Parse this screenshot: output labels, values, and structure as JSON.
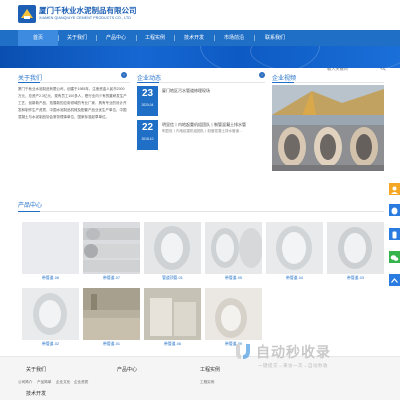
{
  "header": {
    "company_name": "厦门千秋业水泥制品有限公司",
    "company_name_en": "XIAMEN QIANQIUYE CEMENT PRODUCTS CO., LTD"
  },
  "nav": {
    "items": [
      "首页",
      "关于我们",
      "产品中心",
      "工程实例",
      "技术开发",
      "市场前沿",
      "联系我们"
    ],
    "search_placeholder": "输入关键词"
  },
  "about": {
    "title": "关于我们",
    "text": "厦门千秋业水泥制品有限公司，创建于1985年，注册资金人民币2000万元，总资产2.3亿元，现有员工100多人，是行业内少有的集研发生产工艺、创新新产品、拓展新的应用领域的专业厂家，具有专业的设计开发和制作生产资质、中国水泥制品机械及配套产品业优生产单位、中国混凝土与水泥制品协会常务理事单位、国家标准起草单位。"
  },
  "news": {
    "title": "企业动态",
    "items": [
      {
        "day": "23",
        "ym": "2020-04",
        "title": "厦门地区污水管道修理现场",
        "desc": ""
      },
      {
        "day": "22",
        "ym": "2018-10",
        "title": "明显信丨内地起重机组团队丨制管混凝土排水管",
        "desc": "明显信丨内地起重机组团队丨制管混凝土排水管道…"
      }
    ]
  },
  "video": {
    "title": "企业视频"
  },
  "products": {
    "title": "产品中心",
    "items": [
      "带管道-08",
      "带管道-07",
      "管道顶管-01",
      "带管道-05",
      "带管道-04",
      "带管道-03",
      "带管道-02",
      "带管道-01",
      "带管道-06",
      "带管道-09"
    ]
  },
  "footer": {
    "cols": [
      {
        "head": "关于我们",
        "links": [
          "公司简介",
          "产品简单",
          "企业文化",
          "企业资质",
          "技术开发"
        ]
      },
      {
        "head": "产品中心",
        "links": []
      },
      {
        "head": "工程实例",
        "links": [
          "工程实例"
        ]
      }
    ]
  },
  "watermark": {
    "text": "自动秒收录",
    "sub": "一键提交→来访一次→自动秒收"
  },
  "colors": {
    "brand": "#1f6fc7",
    "nav": "#1f6fc7"
  }
}
